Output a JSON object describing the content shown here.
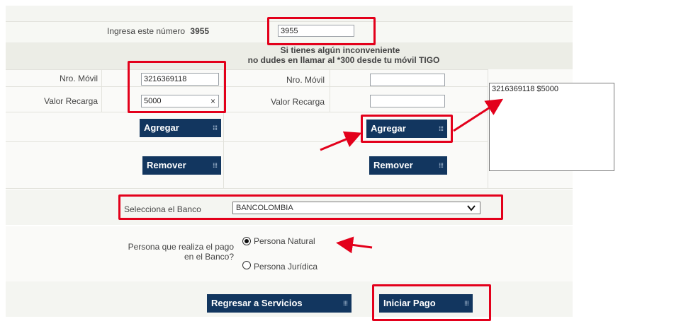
{
  "captcha": {
    "label": "Ingresa este número",
    "code": "3955",
    "value": "3955"
  },
  "notice": {
    "line1": "Si tienes algún inconveniente",
    "line2": "no dudes en llamar al *300 desde tu móvil TIGO"
  },
  "recharge_left": {
    "movil_label": "Nro. Móvil",
    "movil_value": "3216369118",
    "valor_label": "Valor Recarga",
    "valor_value": "5000",
    "clear_glyph": "×"
  },
  "recharge_right": {
    "movil_label": "Nro. Móvil",
    "movil_value": "",
    "valor_label": "Valor Recarga",
    "valor_value": ""
  },
  "buttons": {
    "agregar": "Agregar",
    "remover": "Remover",
    "regresar": "Regresar a Servicios",
    "iniciar": "Iniciar Pago",
    "dots": "⁞⁞⁞"
  },
  "list": {
    "items": [
      "3216369118 $5000"
    ]
  },
  "bank": {
    "label": "Selecciona el Banco",
    "selected": "BANCOLOMBIA"
  },
  "payer": {
    "label_line1": "Persona que realiza el pago",
    "label_line2": "en el Banco?",
    "options": [
      "Persona Natural",
      "Persona Jurídica"
    ],
    "selected_index": 0
  },
  "colors": {
    "button_bg": "#12365f",
    "highlight": "#e3001b",
    "band_bg": "#f4f5f1"
  }
}
